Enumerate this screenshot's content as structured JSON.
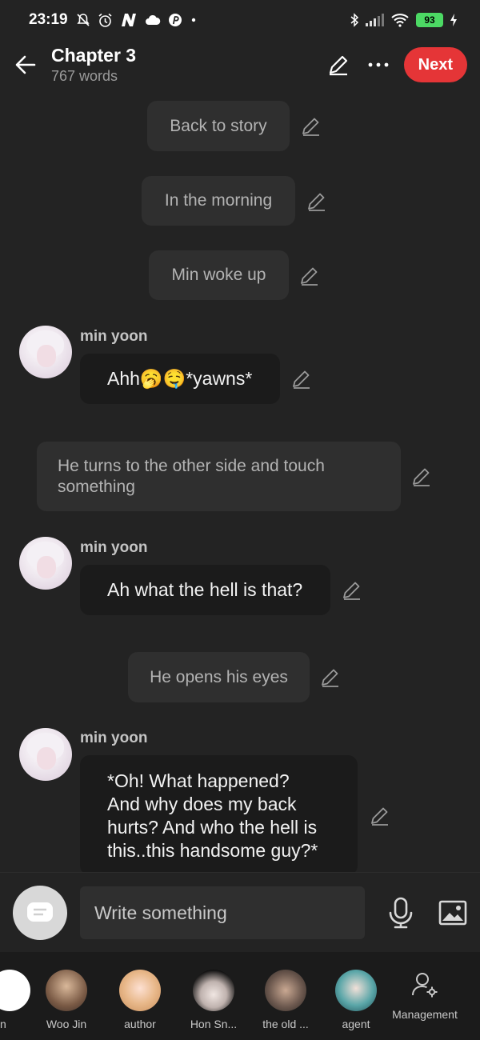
{
  "status_bar": {
    "time": "23:19",
    "battery": "93"
  },
  "header": {
    "title": "Chapter 3",
    "subtitle": "767 words",
    "next_label": "Next"
  },
  "feed": {
    "narration_1": "Back to story",
    "narration_2": "In the morning",
    "narration_3": "Min woke up",
    "message_1": {
      "speaker": "min yoon",
      "text": "Ahh🥱🤤*yawns*"
    },
    "narration_4_line1": "He turns to the other side and touch",
    "narration_4_line2": "something",
    "message_2": {
      "speaker": "min yoon",
      "text": "Ah what the hell is that?"
    },
    "narration_5": "He opens his eyes",
    "message_3": {
      "speaker": "min yoon",
      "lines": [
        "*Oh! What happened?",
        "And why does my back",
        "hurts? And who the hell is",
        "this..this handsome guy?*"
      ]
    }
  },
  "composer": {
    "placeholder": "Write something"
  },
  "characters": [
    {
      "label": "n"
    },
    {
      "label": "Woo Jin"
    },
    {
      "label": "author"
    },
    {
      "label": "Hon Sn..."
    },
    {
      "label": "the old ..."
    },
    {
      "label": "agent"
    },
    {
      "label": "Management"
    }
  ]
}
